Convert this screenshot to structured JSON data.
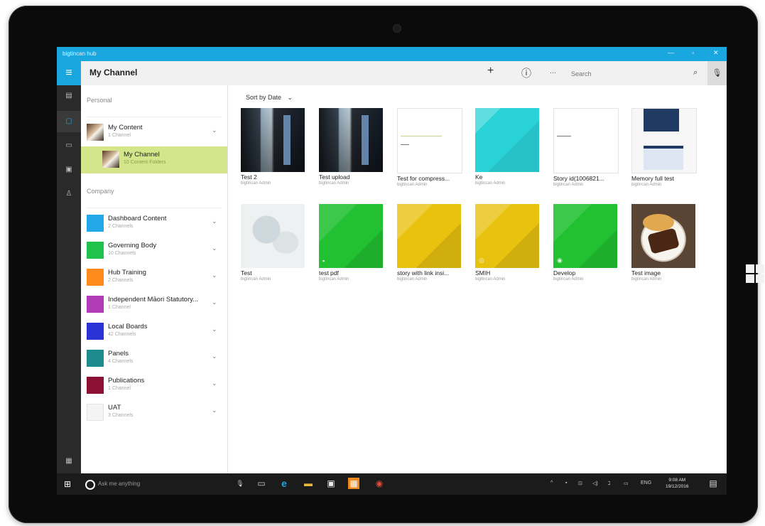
{
  "window": {
    "app_title": "bigtincan hub",
    "controls": [
      "—",
      "▫",
      "✕"
    ]
  },
  "header": {
    "title": "My Channel",
    "add_icon": "+",
    "info_icon": "ⓘ",
    "more_icon": "···",
    "search_placeholder": "Search",
    "search_icon": "⌕",
    "mic_icon": "🎙"
  },
  "rail": {
    "menu_icon": "≡",
    "items": [
      "▤",
      "▢",
      "▭",
      "▣",
      "♙"
    ],
    "bottom_icon": "▦"
  },
  "panel": {
    "personal_label": "Personal",
    "company_label": "Company",
    "personal_items": [
      {
        "name": "My Content",
        "sub": "1 Channel",
        "chevron": "⌄"
      },
      {
        "name": "My Channel",
        "sub": "10 Content Folders"
      }
    ],
    "company_items": [
      {
        "name": "Dashboard Content",
        "sub": "2 Channels",
        "color": "#22a8e8"
      },
      {
        "name": "Governing Body",
        "sub": "10 Channels",
        "color": "#1fc24a"
      },
      {
        "name": "Hub Training",
        "sub": "2 Channels",
        "color": "#ff8a1e"
      },
      {
        "name": "Independent Māori Statutory...",
        "sub": "1 Channel",
        "color": "#b23bb8"
      },
      {
        "name": "Local Boards",
        "sub": "42 Channels",
        "color": "#2a33d6"
      },
      {
        "name": "Panels",
        "sub": "4 Channels",
        "color": "#1e8c8c"
      },
      {
        "name": "Publications",
        "sub": "1 Channel",
        "color": "#8c0f34"
      },
      {
        "name": "UAT",
        "sub": "3 Channels",
        "color": "#f4f4f4"
      }
    ],
    "chevron": "⌄"
  },
  "main": {
    "sort_label": "Sort by Date",
    "sort_chevron": "⌄",
    "tiles": [
      {
        "name": "Test 2",
        "author": "bigtincan Admin"
      },
      {
        "name": "Test upload",
        "author": "bigtincan Admin"
      },
      {
        "name": "Test for compress...",
        "author": "bigtincan Admin"
      },
      {
        "name": "Ke",
        "author": "bigtincan Admin"
      },
      {
        "name": "Story id(1006821...",
        "author": "bigtincan Admin"
      },
      {
        "name": "Memory full test",
        "author": "bigtincan Admin"
      },
      {
        "name": "Test",
        "author": "bigtincan Admin"
      },
      {
        "name": "test pdf",
        "author": "bigtincan Admin"
      },
      {
        "name": "story with link insi...",
        "author": "bigtincan Admin"
      },
      {
        "name": "SMIH",
        "author": "bigtincan Admin"
      },
      {
        "name": "Develop",
        "author": "bigtincan Admin"
      },
      {
        "name": "Test image",
        "author": "bigtincan Admin"
      }
    ],
    "tile_badges": {
      "pdf": "▪",
      "link": "◎",
      "view": "◉"
    }
  },
  "taskbar": {
    "start_icon": "⊞",
    "cortana_placeholder": "Ask me anything",
    "mic_icon": "🎙",
    "taskview_icon": "▭",
    "apps": [
      "e",
      "▬",
      "▣",
      "▦",
      "◉"
    ],
    "tray": [
      "^",
      "▪",
      "⊡",
      "◁)",
      "ℷ",
      "▭",
      "ENG"
    ],
    "time": "9:08 AM",
    "date": "19/12/2016",
    "notification_icon": "▤"
  }
}
